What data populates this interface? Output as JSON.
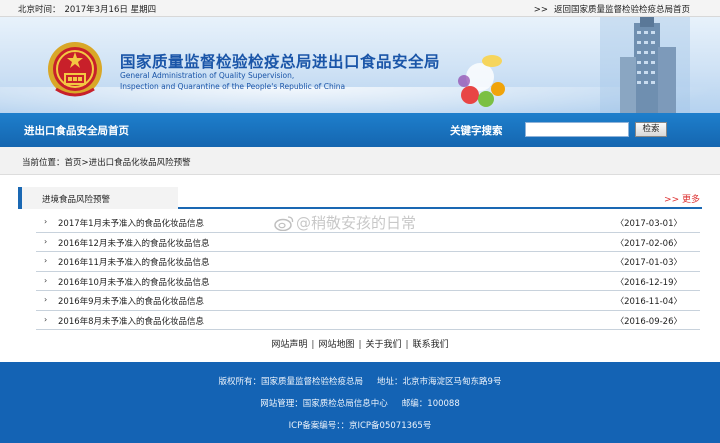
{
  "topbar": {
    "date_label": "北京时间：",
    "date_value": "2017年3月16日 星期四",
    "back_arrow": ">>",
    "back_link": "返回国家质量监督检验检疫总局首页"
  },
  "banner": {
    "title_cn": "国家质量监督检验检疫总局进出口食品安全局",
    "title_en_1": "General Administration of Quality Supervision,",
    "title_en_2": "Inspection and Quarantine of the People's Republic of China"
  },
  "nav": {
    "home": "进出口食品安全局首页",
    "keyword_label": "关键字搜索",
    "search_value": "",
    "search_button": "检索"
  },
  "breadcrumb": {
    "text": "当前位置：首页>进出口食品化妆品风险预警"
  },
  "section": {
    "tab_label": "进境食品风险预警",
    "more": ">> 更多",
    "rows": [
      {
        "title": "2017年1月未予准入的食品化妆品信息",
        "date": "〈2017-03-01〉"
      },
      {
        "title": "2016年12月未予准入的食品化妆品信息",
        "date": "〈2017-02-06〉"
      },
      {
        "title": "2016年11月未予准入的食品化妆品信息",
        "date": "〈2017-01-03〉"
      },
      {
        "title": "2016年10月未予准入的食品化妆品信息",
        "date": "〈2016-12-19〉"
      },
      {
        "title": "2016年9月未予准入的食品化妆品信息",
        "date": "〈2016-11-04〉"
      },
      {
        "title": "2016年8月未予准入的食品化妆品信息",
        "date": "〈2016-09-26〉"
      }
    ]
  },
  "watermark": {
    "text": "@稍敬安孩的日常"
  },
  "footer_links": {
    "statement": "网站声明",
    "sitemap": "网站地图",
    "about": "关于我们",
    "contact": "联系我们",
    "sep": "|"
  },
  "footer": {
    "owner": "版权所有：国家质量监督检验检疫总局",
    "address": "地址：北京市海淀区马甸东路9号",
    "management": "网站管理：国家质检总局信息中心",
    "postcode": "邮编：100088",
    "icp": "ICP备案编号：：京ICP备05071365号"
  },
  "colors": {
    "nav_blue": "#1566b0",
    "footer_blue": "#1463b4",
    "title_blue": "#1a55a8",
    "more_red": "#dd3333"
  }
}
